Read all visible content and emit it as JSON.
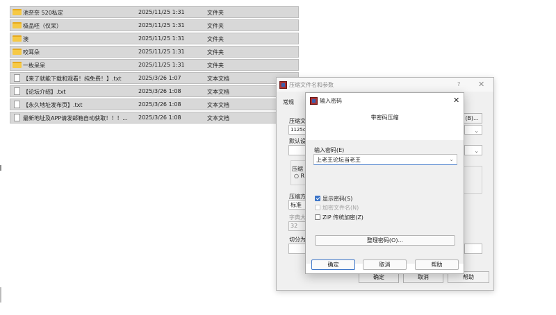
{
  "files": [
    {
      "name": "池奈奈 520私定",
      "date": "2025/11/25 1:31",
      "type": "文件夹",
      "icon": "folder-icon"
    },
    {
      "name": "极品呸（仅呆）",
      "date": "2025/11/25 1:31",
      "type": "文件夹",
      "icon": "folder-icon"
    },
    {
      "name": "澳",
      "date": "2025/11/25 1:31",
      "type": "文件夹",
      "icon": "folder-icon"
    },
    {
      "name": "咬耳朵",
      "date": "2025/11/25 1:31",
      "type": "文件夹",
      "icon": "folder-icon"
    },
    {
      "name": "一枚呆呆",
      "date": "2025/11/25 1:31",
      "type": "文件夹",
      "icon": "folder-icon"
    },
    {
      "name": "【来了就能下载和观看！纯免费！】.txt",
      "date": "2025/3/26 1:07",
      "type": "文本文档",
      "icon": "text-file-icon"
    },
    {
      "name": "【论坛介绍】.txt",
      "date": "2025/3/26 1:08",
      "type": "文本文档",
      "icon": "text-file-icon"
    },
    {
      "name": "【永久地址发布页】.txt",
      "date": "2025/3/26 1:08",
      "type": "文本文档",
      "icon": "text-file-icon"
    },
    {
      "name": "最新地址及APP请发邮箱自动获取！！！...",
      "date": "2025/3/26 1:08",
      "type": "文本文档",
      "icon": "text-file-icon"
    }
  ],
  "archive_dialog": {
    "title": "压缩文件名和参数",
    "help": "?",
    "close": "✕",
    "tab_general": "常规",
    "archive_name_label": "压缩文",
    "archive_name_value": "1125cl",
    "browse_button": "(B)...",
    "default_profile_label": "默认设",
    "format_label": "压缩",
    "format_option": "○ R",
    "method_label": "压缩方",
    "method_value": "标准",
    "dict_label": "字典大",
    "dict_value": "32",
    "split_label": "切分为",
    "ok": "确定",
    "cancel": "取消",
    "help_button": "帮助"
  },
  "password_dialog": {
    "title": "输入密码",
    "close": "✕",
    "subtitle": "带密码压缩",
    "password_label": "输入密码(E)",
    "password_value": "上老王论坛当老王",
    "show_password": "显示密码(S)",
    "show_password_checked": true,
    "encrypt_names": "加密文件名(N)",
    "zip_legacy": "ZIP 传统加密(Z)",
    "organize_button": "整理密码(O)...",
    "ok": "确定",
    "cancel": "取消",
    "help": "帮助"
  }
}
